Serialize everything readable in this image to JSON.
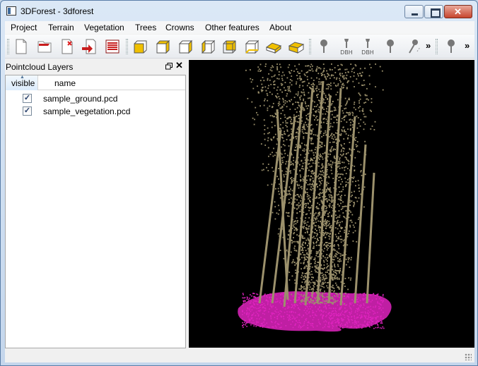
{
  "window": {
    "title": "3DForest - 3dforest"
  },
  "menu": [
    "Project",
    "Terrain",
    "Vegetation",
    "Trees",
    "Crowns",
    "Other features",
    "About"
  ],
  "toolbar": {
    "dbh_label_1": "DBH",
    "dbh_label_2": "DBH",
    "overflow_1": "»",
    "overflow_2": "»"
  },
  "dock": {
    "title": "Pointcloud Layers",
    "columns": {
      "visible": "visible",
      "name": "name"
    },
    "layers": [
      {
        "name": "sample_ground.pcd",
        "visible": true
      },
      {
        "name": "sample_vegetation.pcd",
        "visible": true
      }
    ]
  },
  "viewer": {
    "background": "#000000",
    "vegetation_color": "#9c916c",
    "ground_color": "#e024c0"
  },
  "colors": {
    "titlebar": "#c4d6ec",
    "close": "#c7452d",
    "cube_fill": "#f0c000"
  }
}
